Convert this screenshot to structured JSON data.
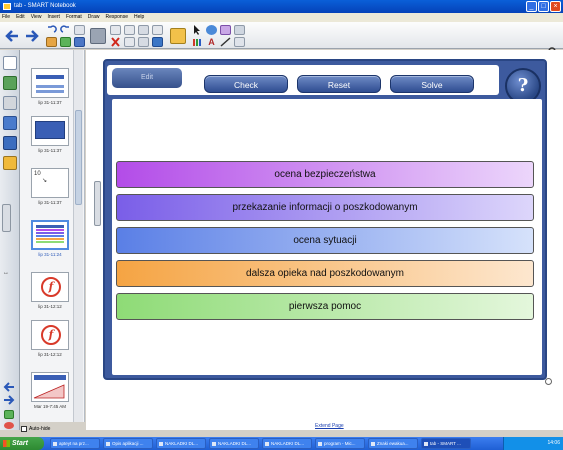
{
  "window": {
    "title": "tab - SMART Notebook"
  },
  "menu": [
    "File",
    "Edit",
    "View",
    "Insert",
    "Format",
    "Draw",
    "Response",
    "Help"
  ],
  "sorter": {
    "thumbnails": [
      {
        "label": "lip 31-11:37"
      },
      {
        "label": "lip 31-11:37"
      },
      {
        "label": "lip 31-11:37"
      },
      {
        "label": "lip 31-11:24"
      },
      {
        "label": "lip 31-12:12"
      },
      {
        "label": "lip 31-12:12"
      },
      {
        "label": "Mar 19-7:45 AM"
      }
    ],
    "autohide_label": "Auto-hide"
  },
  "activity": {
    "edit_label": "Edit",
    "check_label": "Check",
    "reset_label": "Reset",
    "solve_label": "Solve",
    "help_label": "?",
    "items": [
      {
        "label": "ocena bezpieczeństwa",
        "color_from": "#b34ce8",
        "color_to": "#ecd6fb"
      },
      {
        "label": "przekazanie informacji o poszkodowanym",
        "color_from": "#7a5ee8",
        "color_to": "#ddd6fb"
      },
      {
        "label": "ocena sytuacji",
        "color_from": "#5a7fe6",
        "color_to": "#d6e2fb"
      },
      {
        "label": "dalsza opieka nad poszkodowanym",
        "color_from": "#f5a443",
        "color_to": "#fde7cf"
      },
      {
        "label": "pierwsza pomoc",
        "color_from": "#8edb76",
        "color_to": "#e4f7dc"
      }
    ]
  },
  "extend_page": "Extend Page",
  "taskbar": {
    "start_label": "Start",
    "tasks": [
      "apteyt na prz...",
      "Opis aplikacji ...",
      "NAKLADKI DL...",
      "NAKLADKI DL...",
      "NAKLADKI DL...",
      "program - Mic...",
      "Znaki ewakua...",
      "tab - SMART ..."
    ],
    "clock": "14:06"
  }
}
